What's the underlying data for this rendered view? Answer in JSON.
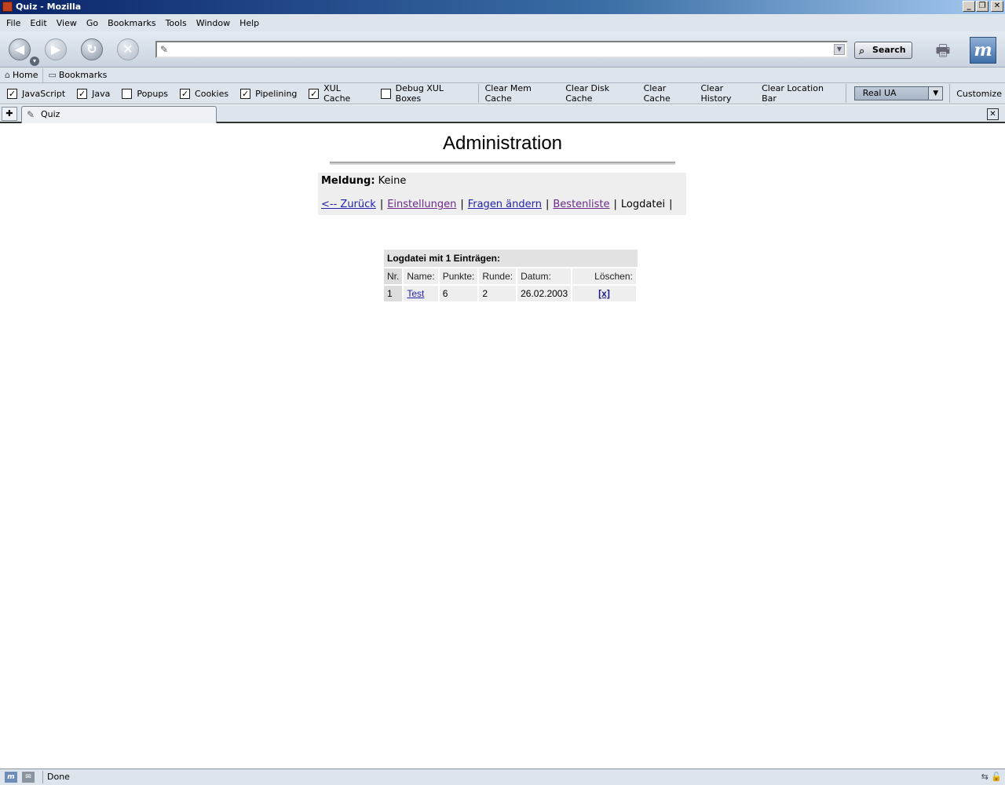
{
  "window": {
    "title": "Quiz - Mozilla"
  },
  "menu": [
    "File",
    "Edit",
    "View",
    "Go",
    "Bookmarks",
    "Tools",
    "Window",
    "Help"
  ],
  "nav": {
    "url_value": "",
    "search_label": "Search"
  },
  "personal": {
    "home": "Home",
    "bookmarks": "Bookmarks"
  },
  "prefbar": {
    "checks": [
      {
        "label": "JavaScript",
        "checked": true
      },
      {
        "label": "Java",
        "checked": true
      },
      {
        "label": "Popups",
        "checked": false
      },
      {
        "label": "Cookies",
        "checked": true
      },
      {
        "label": "Pipelining",
        "checked": true
      },
      {
        "label": "XUL Cache",
        "checked": true
      },
      {
        "label": "Debug XUL Boxes",
        "checked": false
      }
    ],
    "buttons": [
      "Clear Mem Cache",
      "Clear Disk Cache",
      "Clear Cache",
      "Clear History",
      "Clear Location Bar"
    ],
    "ua_select": "Real UA",
    "customize": "Customize"
  },
  "tab": {
    "title": "Quiz"
  },
  "page": {
    "title": "Administration",
    "message_label": "Meldung:",
    "message_value": "Keine",
    "links": {
      "back": "<-- Zurück",
      "settings": "Einstellungen",
      "questions": "Fragen ändern",
      "leaderboard": "Bestenliste",
      "logfile": "Logdatei"
    },
    "table": {
      "caption": "Logdatei mit 1 Einträgen:",
      "columns": [
        "Nr.",
        "Name:",
        "Punkte:",
        "Runde:",
        "Datum:",
        "Löschen:"
      ],
      "rows": [
        {
          "nr": "1",
          "name": "Test",
          "punkte": "6",
          "runde": "2",
          "datum": "26.02.2003",
          "delete": "[x]"
        }
      ]
    }
  },
  "status": {
    "text": "Done"
  }
}
